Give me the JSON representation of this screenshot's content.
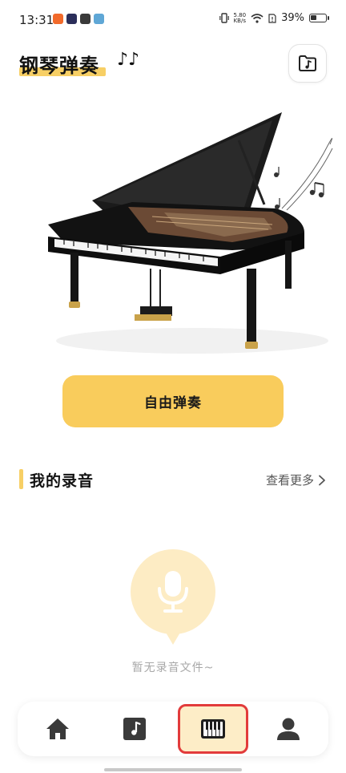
{
  "status_bar": {
    "time": "13:31",
    "speed_value": "5.80",
    "speed_unit": "KB/s",
    "battery": "39%",
    "battery_level": 0.39
  },
  "header": {
    "title": "钢琴弹奏",
    "notes_glyph": "♪♪"
  },
  "main": {
    "free_play_label": "自由弹奏"
  },
  "recordings": {
    "title": "我的录音",
    "more_label": "查看更多",
    "empty_text": "暂无录音文件~"
  },
  "nav": {
    "items": [
      {
        "icon": "home-icon",
        "active": false
      },
      {
        "icon": "music-file-icon",
        "active": false
      },
      {
        "icon": "piano-keys-icon",
        "active": true
      },
      {
        "icon": "profile-icon",
        "active": false
      }
    ]
  },
  "colors": {
    "accent": "#f9cc5c",
    "highlight": "#f7cf65",
    "bubble": "#fdecc4",
    "active_border": "#e23b3b"
  }
}
